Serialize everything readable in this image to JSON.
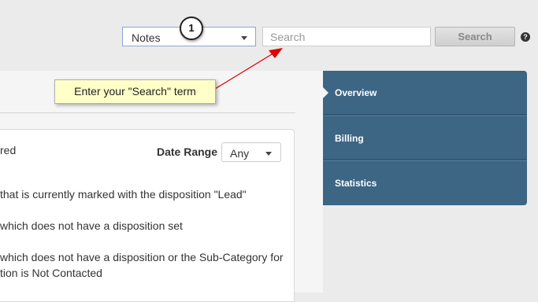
{
  "search_bar": {
    "type_select_value": "Notes",
    "search_placeholder": "Search",
    "search_button_label": "Search",
    "help_icon_glyph": "?"
  },
  "annotation": {
    "callout_number": "1",
    "tooltip_text": "Enter your \"Search\" term",
    "arrow_color": "#e00000"
  },
  "filter_card": {
    "status_fragment": "red",
    "date_range_label": "Date Range",
    "date_range_value": "Any",
    "lines": [
      "that is currently marked with the disposition \"Lead\"",
      "which does not have a disposition set",
      "which does not have a disposition or the Sub-Category for",
      "tion is Not Contacted"
    ]
  },
  "nav": {
    "items": [
      {
        "label": "Overview"
      },
      {
        "label": "Billing"
      },
      {
        "label": "Statistics"
      }
    ],
    "background": "#3d6584"
  }
}
